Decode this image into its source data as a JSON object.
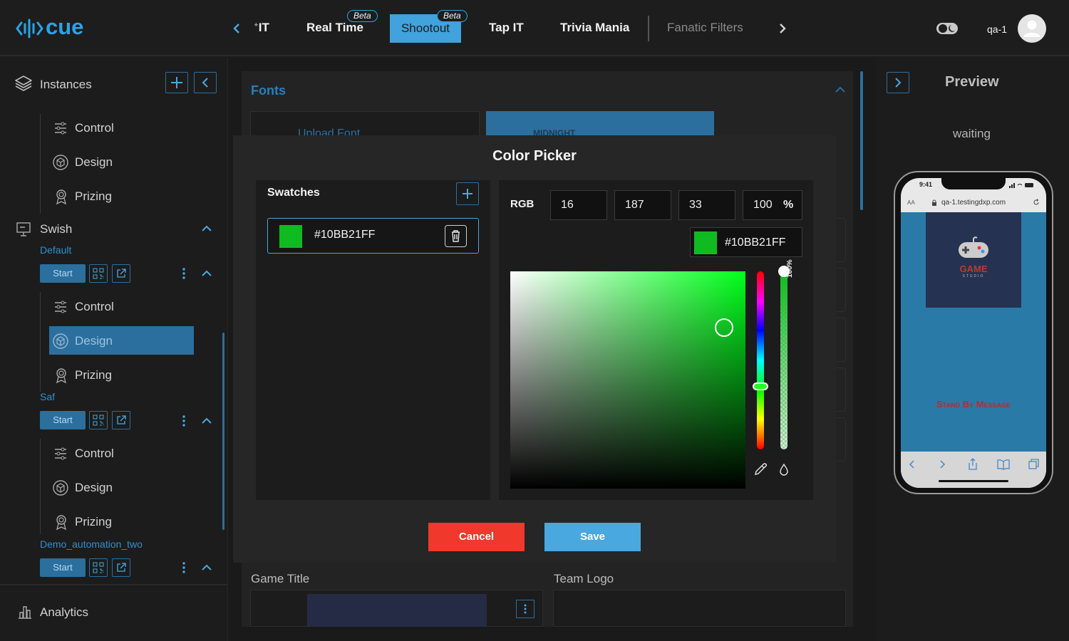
{
  "app": {
    "logo": "cue"
  },
  "nav": {
    "tabs": [
      {
        "label": "IT"
      },
      {
        "label": "Real Time",
        "badge": "Beta"
      },
      {
        "label": "Shootout",
        "badge": "Beta",
        "active": true
      },
      {
        "label": "Tap IT"
      },
      {
        "label": "Trivia Mania"
      },
      {
        "label": "Fanatic Filters"
      }
    ]
  },
  "user": {
    "name": "qa-1"
  },
  "sidebar": {
    "instances_label": "Instances",
    "top_items": [
      "Control",
      "Design",
      "Prizing"
    ],
    "group": "Swish",
    "instances": [
      {
        "name": "Default",
        "start": "Start",
        "items": [
          "Control",
          "Design",
          "Prizing"
        ],
        "selected": "Design"
      },
      {
        "name": "Saf",
        "start": "Start",
        "items": [
          "Control",
          "Design",
          "Prizing"
        ]
      },
      {
        "name": "Demo_automation_two",
        "start": "Start"
      }
    ],
    "analytics": "Analytics"
  },
  "main": {
    "fonts_title": "Fonts",
    "upload_font": "Upload Font",
    "font_card": "Midnight",
    "game_title": "Game Title",
    "team_logo": "Team Logo"
  },
  "color_picker": {
    "title": "Color Picker",
    "swatches_label": "Swatches",
    "swatch_hex": "#10BB21FF",
    "mode": "RGB",
    "r": "16",
    "g": "187",
    "b": "33",
    "alpha": "100",
    "alpha_unit": "%",
    "current_hex": "#10BB21FF",
    "alpha_vertical": "100%",
    "cancel": "Cancel",
    "save": "Save",
    "color": "#10bb21"
  },
  "preview": {
    "title": "Preview",
    "status": "waiting",
    "phone_time": "9:41",
    "url": "qa-1.testingdxp.com",
    "aa": "AA",
    "logo_text": "GAME",
    "logo_sub": "STUDIO",
    "message": "Stand By Message"
  }
}
